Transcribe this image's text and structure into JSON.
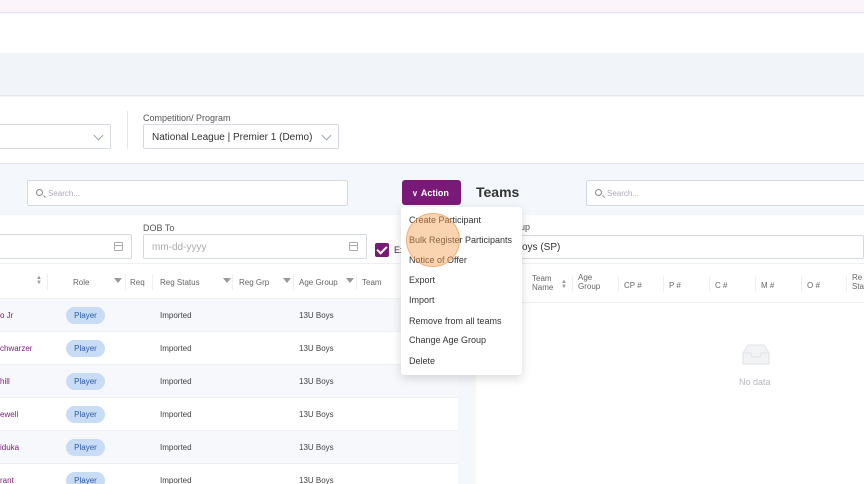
{
  "filters": {
    "competition_label": "Competition/ Program",
    "competition_value": "National League | Premier 1 (Demo)"
  },
  "left": {
    "search_placeholder": "Search...",
    "dob_to_label": "DOB To",
    "dob_to_placeholder": "mm-dd-yyyy",
    "checkbox_label": "Ex",
    "columns": {
      "role": "Role",
      "req": "Req",
      "reg_status": "Reg Status",
      "reg_grp": "Reg Grp",
      "age_group": "Age Group",
      "team": "Team"
    },
    "rows": [
      {
        "name": "o Jr",
        "role": "Player",
        "status": "Imported",
        "age": "13U Boys"
      },
      {
        "name": "chwarzer",
        "role": "Player",
        "status": "Imported",
        "age": "13U Boys"
      },
      {
        "name": "hill",
        "role": "Player",
        "status": "Imported",
        "age": "13U Boys"
      },
      {
        "name": "ewell",
        "role": "Player",
        "status": "Imported",
        "age": "13U Boys"
      },
      {
        "name": "iduka",
        "role": "Player",
        "status": "Imported",
        "age": "13U Boys"
      },
      {
        "name": "rant",
        "role": "Player",
        "status": "Imported",
        "age": "13U Boys"
      }
    ]
  },
  "action": {
    "button_label": "Action",
    "menu": [
      "Create Participant",
      "Bulk Register Participants",
      "Notice of Offer",
      "Export",
      "Import",
      "Remove from all teams",
      "Change Age Group",
      "Delete"
    ]
  },
  "right": {
    "title": "Teams",
    "search_placeholder": "Search...",
    "group_label": "up",
    "group_value": "oys (SP)",
    "columns": [
      "Team Name",
      "Age Group",
      "CP #",
      "P #",
      "C #",
      "M #",
      "O #",
      "Re Sta"
    ],
    "empty_text": "No data"
  },
  "colors": {
    "accent": "#7a1a78",
    "role_badge": "#c9dcf5"
  }
}
